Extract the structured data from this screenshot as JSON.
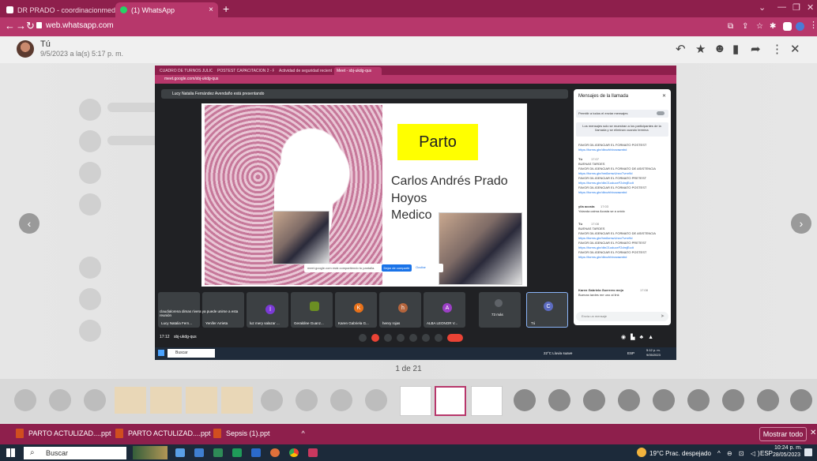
{
  "browser": {
    "tabs": [
      {
        "label": "DR PRADO - coordinacionmedic",
        "close": "×"
      },
      {
        "label": "(1) WhatsApp",
        "close": "×"
      }
    ],
    "new_tab": "+",
    "url": "web.whatsapp.com"
  },
  "viewer": {
    "sender": "Tú",
    "timestamp": "9/5/2023 a la(s) 5:17 p. m.",
    "counter": "1 de 21"
  },
  "screenshot": {
    "tabs": [
      "CUADRO DE TURNOS JULIO 20...",
      "POSTEST CAPACITACION 2 - Par...",
      "Actividad de seguridad reciente",
      "Meet - sbj-ukdg-qus"
    ],
    "url": "meet.google.com/sbj-ukdg-qus",
    "presenter_banner": "Lucy Natalia Fernández Avendaño está presentando",
    "slide": {
      "title": "Parto",
      "lines": [
        "Carlos Andrés Prado",
        "Hoyos",
        "Medico"
      ]
    },
    "share_notice": "meet.google.com está compartiendo tu pantalla.",
    "share_stop": "Dejar de compartir",
    "share_hide": "Ocultar",
    "chat": {
      "title": "Mensajes de la llamada",
      "toggle_label": "Permitir a todos el enviar mensajes",
      "notice": "Los mensajes solo se muestran a los participantes de la llamada y se eliminan cuando termina",
      "messages": [
        {
          "text": "FAVOR DILIGENCIAR EL FORMATO POSTEST",
          "link": "https://forms.gle/dbxzhhbvwawnbd"
        },
        {
          "author": "Tú",
          "time": "17:07",
          "text": "BUENAS TARDES"
        },
        {
          "text": "FAVOR DILIGENCIAR EL FORMATO DE ASISTENCIA",
          "link": "https://forms.gle/hm8zmwUnxoTvmr9d"
        },
        {
          "text": "FAVOR DILIGENCIAR EL FORMATO PRETEST",
          "link": "https://forms.gle/dbr21oduceF2dmjEcdt"
        },
        {
          "text": "FAVOR DILIGENCIAR EL FORMATO POSTEST",
          "link": "https://forms.gle/dbxzhhbvwawnbd"
        },
        {
          "author": "yila acosta",
          "time": "17:03",
          "text": "Yolanda caima  Acosta se a unido"
        },
        {
          "author": "Tú",
          "time": "17:08",
          "text": "BUENAS TARDES"
        },
        {
          "text": "FAVOR DILIGENCIAR EL FORMATO DE ASISTENCIA",
          "link": "https://forms.gle/hm8zmwUnxoTvmr9d"
        },
        {
          "text": "FAVOR DILIGENCIAR EL FORMATO PRETEST",
          "link": "https://forms.gle/dbr21oduceF2dmjEcdt"
        },
        {
          "text": "FAVOR DILIGENCIAR EL FORMATO POSTEST",
          "link": "https://forms.gle/dbxzhhbvwawnbd"
        },
        {
          "author": "Karen Gabriela Guerrero mejo",
          "time": "17:08",
          "text": "Buenas tardes me uno al link"
        }
      ],
      "input_placeholder": "Envía un mensaje"
    },
    "tiles": [
      {
        "name": "Lucy Natalia Fern...",
        "initial": ""
      },
      {
        "name": "Yenifer Arrieta",
        "initial": ""
      },
      {
        "name": "luz mery salazar ...",
        "initial": "l"
      },
      {
        "name": "Geraldine Guanz...",
        "initial": ""
      },
      {
        "name": "Karen Gabriela G...",
        "initial": "K"
      },
      {
        "name": "henry rojas",
        "initial": "h"
      },
      {
        "name": "ALBA LEONOR V...",
        "initial": "A"
      },
      {
        "name": "73 más",
        "initial": ""
      },
      {
        "name": "Tú",
        "initial": "C"
      }
    ],
    "left_toast": "claudialorena dimas rivera ya puede unirse a esta reunión",
    "meet_time": "17:12",
    "meet_code": "sbj-ukdg-qus",
    "taskbar_search": "Buscar",
    "weather": "22°C  Lluvia suave",
    "lang": "ESP",
    "clock": "5:12 p. m.",
    "date": "9/05/2023"
  },
  "downloads": {
    "items": [
      "PARTO ACTULIZAD....ppt",
      "PARTO ACTULIZAD....ppt",
      "Sepsis (1).ppt"
    ],
    "show_all": "Mostrar todo"
  },
  "taskbar": {
    "search": "Buscar",
    "weather": "19°C  Prac. despejado",
    "lang": "ESP",
    "time": "10:24 p. m.",
    "date": "28/05/2023"
  }
}
